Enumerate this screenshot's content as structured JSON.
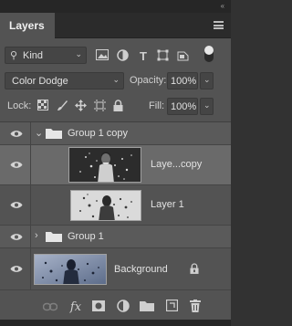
{
  "window": {
    "collapse_glyph": "‹‹"
  },
  "tabs": [
    {
      "label": "Layers"
    }
  ],
  "filter": {
    "kind_label": "Kind",
    "icons": [
      "pixel-layer-filter-icon",
      "adjustment-layer-filter-icon",
      "type-layer-filter-icon",
      "shape-layer-filter-icon",
      "smart-object-filter-icon"
    ],
    "toggle": "on"
  },
  "blend": {
    "mode": "Color Dodge",
    "opacity_label": "Opacity:",
    "opacity_value": "100%"
  },
  "lock": {
    "label": "Lock:",
    "fill_label": "Fill:",
    "fill_value": "100%"
  },
  "layers": [
    {
      "type": "group",
      "name": "Group 1 copy",
      "expanded": true,
      "visible": true,
      "selected": false
    },
    {
      "type": "smart",
      "name": "Laye...copy",
      "visible": true,
      "selected": true,
      "indent": 1
    },
    {
      "type": "pixel",
      "name": "Layer 1",
      "visible": true,
      "selected": false,
      "indent": 1
    },
    {
      "type": "group",
      "name": "Group 1",
      "expanded": false,
      "visible": true,
      "selected": false
    },
    {
      "type": "background",
      "name": "Background",
      "visible": true,
      "selected": false,
      "locked": true
    }
  ],
  "bottom_icons": [
    "link-layers-icon",
    "fx-icon",
    "add-mask-icon",
    "adjustment-layer-icon",
    "new-group-icon",
    "new-layer-icon",
    "delete-layer-icon"
  ],
  "colors": {
    "panel_bg": "#535353",
    "selected_row": "#696969",
    "group_row": "#5c5c5c",
    "field_bg": "#454545"
  }
}
